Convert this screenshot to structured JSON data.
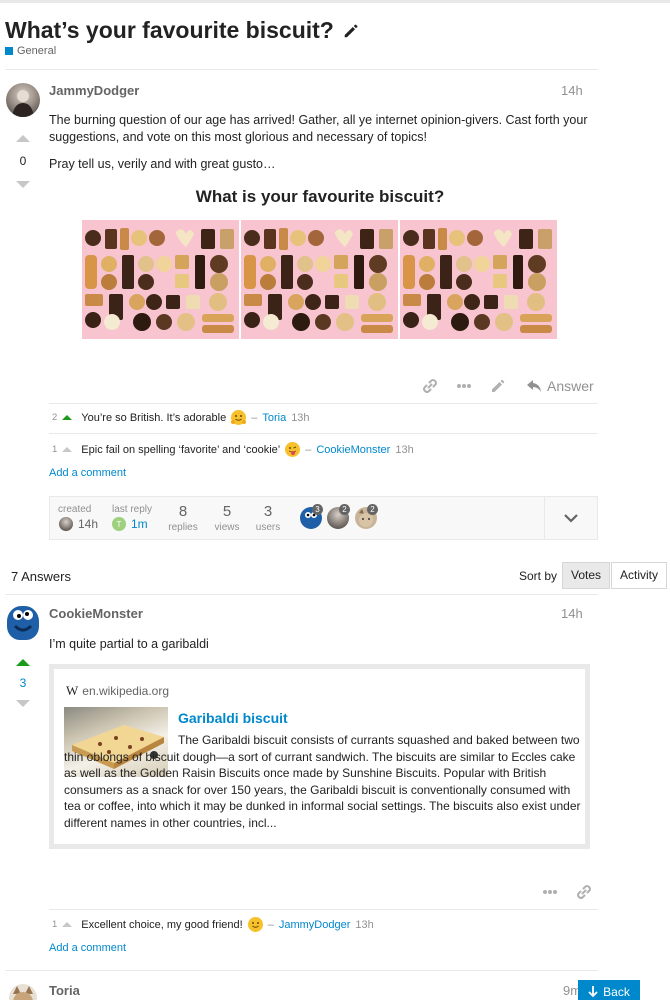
{
  "topic": {
    "title": "What’s your favourite biscuit?",
    "category": "General",
    "category_color": "#0088cc"
  },
  "question": {
    "username": "JammyDodger",
    "date": "14h",
    "votes": "0",
    "body_1": "The burning question of our age has arrived! Gather, all ye internet opinion-givers. Cast forth your suggestions, and vote on this most glorious and necessary of topics!",
    "body_2": "Pray tell us, verily and with great gusto…",
    "poll_title": "What is your favourite biscuit?",
    "answer_label": "Answer",
    "comments": [
      {
        "num": "2",
        "text": "You’re so British. It’s adorable",
        "author": "Toria",
        "time": "13h"
      },
      {
        "num": "1",
        "text": "Epic fail on spelling ‘favorite’ and ‘cookie’",
        "author": "CookieMonster",
        "time": "13h"
      }
    ],
    "add_comment": "Add a comment"
  },
  "topic_map": {
    "created_label": "created",
    "created_value": "14h",
    "last_reply_label": "last reply",
    "last_reply_value": "1m",
    "replies_value": "8",
    "replies_label": "replies",
    "views_value": "5",
    "views_label": "views",
    "users_value": "3",
    "users_label": "users",
    "participant_counts": [
      "3",
      "2",
      "2"
    ]
  },
  "answers_header": {
    "count_label": "7 Answers",
    "sort_label": "Sort by",
    "sort_votes": "Votes",
    "sort_activity": "Activity"
  },
  "answer_1": {
    "username": "CookieMonster",
    "date": "14h",
    "votes": "3",
    "body": "I’m quite partial to a garibaldi",
    "onebox": {
      "source": "en.wikipedia.org",
      "title": "Garibaldi biscuit",
      "text": "The Garibaldi biscuit consists of currants squashed and baked between two thin oblongs of biscuit dough—a sort of currant sandwich. The biscuits are similar to Eccles cake as well as the Golden Raisin Biscuits once made by Sunshine Biscuits. Popular with British consumers as a snack for over 150 years, the Garibaldi biscuit is conventionally consumed with tea or coffee, into which it may be dunked in informal social settings. The biscuits also exist under different names in other countries, incl..."
    },
    "comments": [
      {
        "num": "1",
        "text": "Excellent choice, my good friend!",
        "author": "JammyDodger",
        "time": "13h"
      }
    ],
    "add_comment": "Add a comment"
  },
  "answer_2": {
    "username": "Toria",
    "date": "9m"
  },
  "back_button": "Back"
}
